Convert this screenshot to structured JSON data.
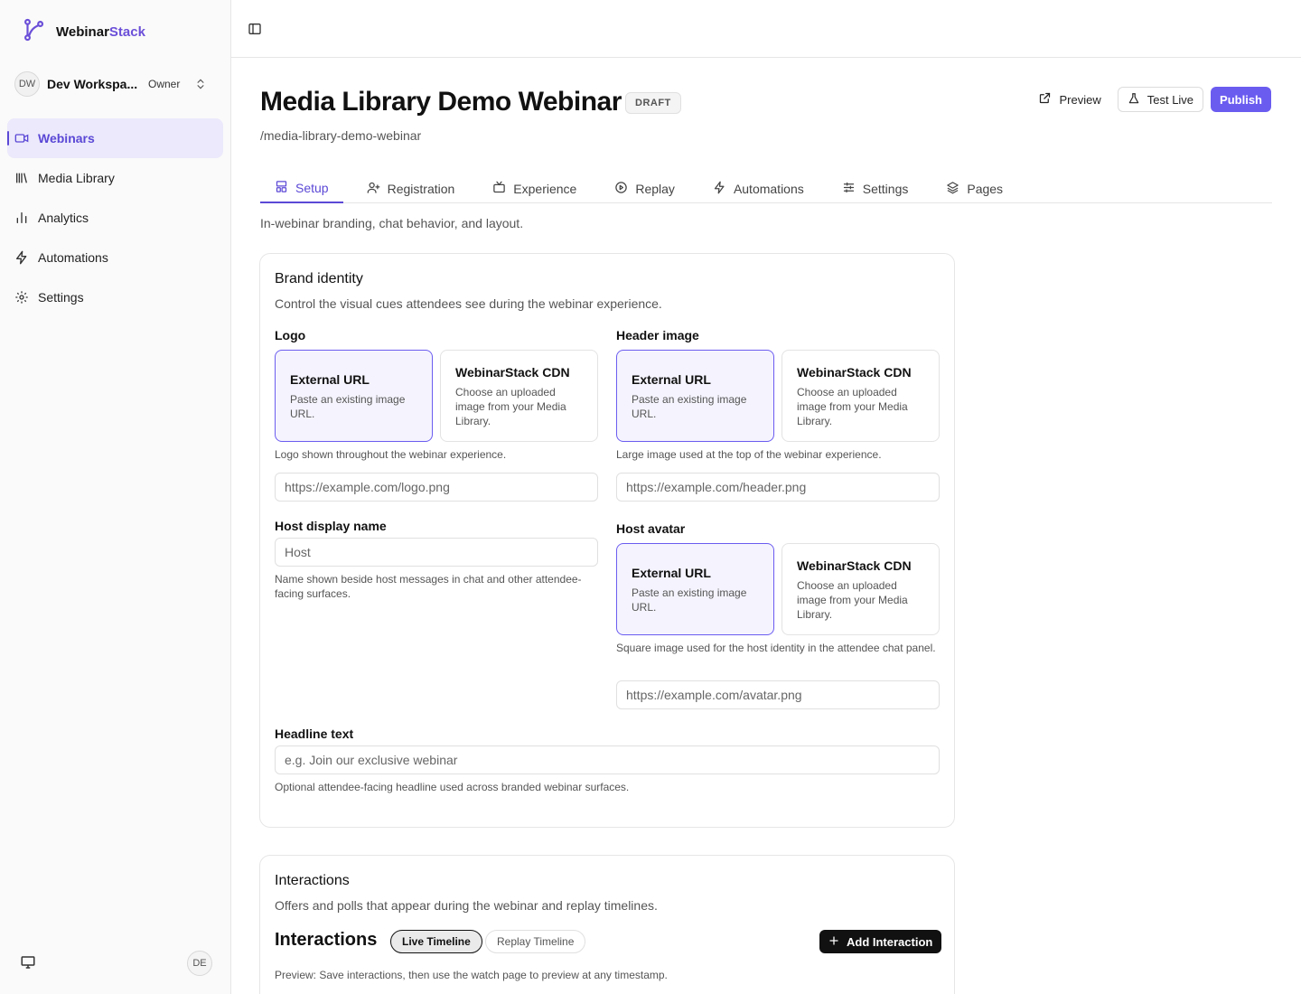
{
  "brand": {
    "name_main": "Webinar",
    "name_accent": "Stack",
    "accent_color": "#6b4fd8"
  },
  "workspace": {
    "initials": "DW",
    "name": "Dev Workspa...",
    "role": "Owner"
  },
  "sidebar": {
    "items": [
      {
        "label": "Webinars",
        "icon": "video-icon",
        "active": true
      },
      {
        "label": "Media Library",
        "icon": "library-icon"
      },
      {
        "label": "Analytics",
        "icon": "bar-chart-icon"
      },
      {
        "label": "Automations",
        "icon": "lightning-icon"
      },
      {
        "label": "Settings",
        "icon": "gear-icon"
      }
    ],
    "user_initials": "DE"
  },
  "header": {
    "title": "Media Library Demo Webinar",
    "status": "DRAFT",
    "slug": "/media-library-demo-webinar",
    "preview_label": "Preview",
    "test_live_label": "Test Live",
    "publish_label": "Publish"
  },
  "tabs": [
    {
      "label": "Setup",
      "icon": "layout-icon",
      "active": true
    },
    {
      "label": "Registration",
      "icon": "user-plus-icon"
    },
    {
      "label": "Experience",
      "icon": "tv-icon"
    },
    {
      "label": "Replay",
      "icon": "play-circle-icon"
    },
    {
      "label": "Automations",
      "icon": "lightning-icon"
    },
    {
      "label": "Settings",
      "icon": "sliders-icon"
    },
    {
      "label": "Pages",
      "icon": "layers-icon"
    }
  ],
  "tab_description": "In-webinar branding, chat behavior, and layout.",
  "brand_identity": {
    "title": "Brand identity",
    "subtitle": "Control the visual cues attendees see during the webinar experience.",
    "source_options": {
      "external_title": "External URL",
      "external_desc": "Paste an existing image URL.",
      "cdn_title": "WebinarStack CDN",
      "cdn_desc": "Choose an uploaded image from your Media Library."
    },
    "logo": {
      "label": "Logo",
      "hint": "Logo shown throughout the webinar experience.",
      "placeholder": "https://example.com/logo.png"
    },
    "header_image": {
      "label": "Header image",
      "hint": "Large image used at the top of the webinar experience.",
      "placeholder": "https://example.com/header.png"
    },
    "host_name": {
      "label": "Host display name",
      "placeholder": "Host",
      "hint": "Name shown beside host messages in chat and other attendee-facing surfaces."
    },
    "host_avatar": {
      "label": "Host avatar",
      "hint": "Square image used for the host identity in the attendee chat panel.",
      "placeholder": "https://example.com/avatar.png"
    },
    "headline": {
      "label": "Headline text",
      "placeholder": "e.g. Join our exclusive webinar",
      "hint": "Optional attendee-facing headline used across branded webinar surfaces."
    }
  },
  "interactions": {
    "card_title": "Interactions",
    "card_subtitle": "Offers and polls that appear during the webinar and replay timelines.",
    "heading": "Interactions",
    "live_timeline": "Live Timeline",
    "replay_timeline": "Replay Timeline",
    "add_label": "Add Interaction",
    "note": "Preview: Save interactions, then use the watch page to preview at any timestamp."
  }
}
